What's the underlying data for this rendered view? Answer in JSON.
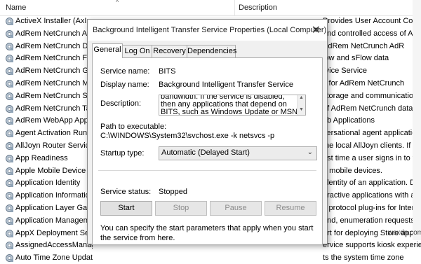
{
  "list": {
    "col_name": "Name",
    "col_description": "Description",
    "rows": [
      {
        "name": "ActiveX Installer (AxInstSV)",
        "desc": "Provides User Account Control validation for the installation"
      },
      {
        "name": "AdRem NetCrunch Adv",
        "desc": "and controlled access of AdRe"
      },
      {
        "name": "AdRem NetCrunch Dat",
        "desc": "AdRem NetCrunch AdR"
      },
      {
        "name": "AdRem NetCrunch Flo",
        "desc": "low and sFlow data"
      },
      {
        "name": "AdRem NetCrunch Gu",
        "desc": "rvice Service"
      },
      {
        "name": "AdRem NetCrunch Me",
        "desc": "s for AdRem NetCrunch"
      },
      {
        "name": "AdRem NetCrunch Ser",
        "desc": "storage and communication in"
      },
      {
        "name": "AdRem NetCrunch Tas",
        "desc": "of AdRem NetCrunch data m"
      },
      {
        "name": "AdRem WebApp Appli",
        "desc": "eb Applications"
      },
      {
        "name": "Agent Activation Runt",
        "desc": "versational agent applications"
      },
      {
        "name": "AllJoyn Router Service",
        "desc": "the local AllJoyn clients. If this"
      },
      {
        "name": "App Readiness",
        "desc": "irst time a user signs in to this"
      },
      {
        "name": "Apple Mobile Device S",
        "desc": "e mobile devices."
      },
      {
        "name": "Application Identity",
        "desc": "identity of an application. Disab"
      },
      {
        "name": "Application Informatio",
        "desc": "eractive applications with additi"
      },
      {
        "name": "Application Layer Gate",
        "desc": "y protocol plug-ins for Interne"
      },
      {
        "name": "Application Manageme",
        "desc": "and, enumeration requests"
      },
      {
        "name": "AppX Deployment Serv",
        "desc": "ort for deploying Store applicati"
      },
      {
        "name": "AssignedAccessManag",
        "desc": "ervice supports kiosk experience"
      },
      {
        "name": "Auto Time Zone Updat",
        "desc": "ts the system time zone"
      }
    ]
  },
  "dialog": {
    "title": "Background Intelligent Transfer Service Properties (Local Computer)",
    "close_glyph": "✕",
    "tabs": [
      {
        "label": "General"
      },
      {
        "label": "Log On"
      },
      {
        "label": "Recovery"
      },
      {
        "label": "Dependencies"
      }
    ],
    "service_name_label": "Service name:",
    "service_name_value": "BITS",
    "display_name_label": "Display name:",
    "display_name_value": "Background Intelligent Transfer Service",
    "description_label": "Description:",
    "description_value": "bandwidth. If the service is disabled, then any applications that depend on BITS, such as Windows Update or MSN Explorer, will be unable to",
    "path_label": "Path to executable:",
    "path_value": "C:\\WINDOWS\\System32\\svchost.exe -k netsvcs -p",
    "startup_label": "Startup type:",
    "startup_value": "Automatic (Delayed Start)",
    "status_label": "Service status:",
    "status_value": "Stopped",
    "buttons": {
      "start": "Start",
      "stop": "Stop",
      "pause": "Pause",
      "resume": "Resume"
    },
    "note": "You can specify the start parameters that apply when you start the service from here."
  },
  "watermark": "wsxdn.com"
}
